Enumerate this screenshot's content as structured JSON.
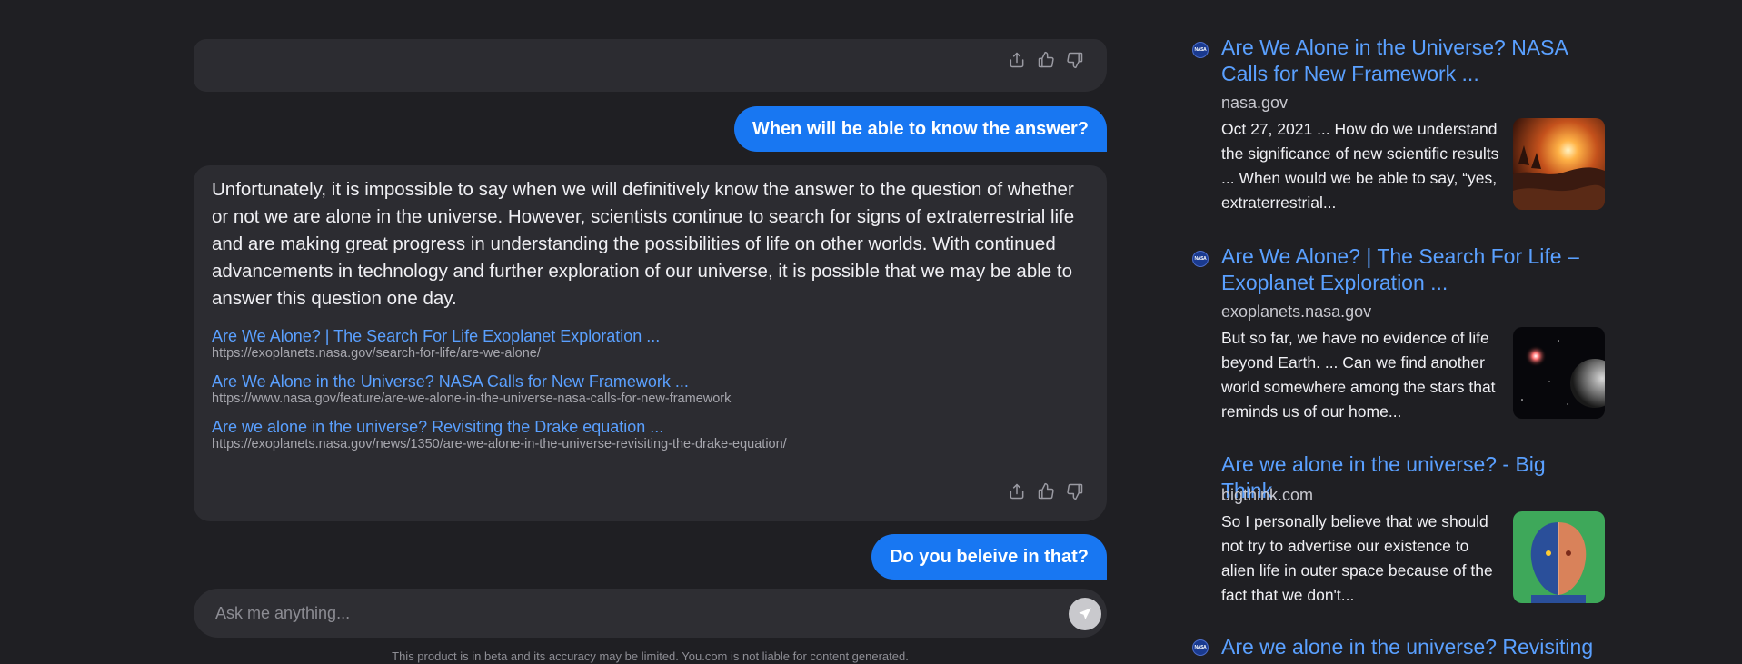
{
  "chat": {
    "user_messages": [
      "When will be able to know the answer?",
      "Do you beleive in that?"
    ],
    "answer": "Unfortunately, it is impossible to say when we will definitively know the answer to the question of whether or not we are alone in the universe. However, scientists continue to search for signs of extraterrestrial life and are making great progress in understanding the possibilities of life on other worlds. With continued advancements in technology and further exploration of our universe, it is possible that we may be able to answer this question one day.",
    "sources": [
      {
        "title": "Are We Alone? | The Search For Life Exoplanet Exploration ...",
        "url": "https://exoplanets.nasa.gov/search-for-life/are-we-alone/"
      },
      {
        "title": "Are We Alone in the Universe? NASA Calls for New Framework ...",
        "url": "https://www.nasa.gov/feature/are-we-alone-in-the-universe-nasa-calls-for-new-framework"
      },
      {
        "title": "Are we alone in the universe? Revisiting the Drake equation ...",
        "url": "https://exoplanets.nasa.gov/news/1350/are-we-alone-in-the-universe-revisiting-the-drake-equation/"
      }
    ],
    "input_placeholder": "Ask me anything...",
    "disclaimer": "This product is in beta and its accuracy may be limited. You.com is not liable for content generated.",
    "icons": [
      "share-icon",
      "thumbs-up-icon",
      "thumbs-down-icon",
      "send-icon"
    ]
  },
  "results": [
    {
      "favicon": "NASA",
      "title": "Are We Alone in the Universe? NASA Calls for New Framework ...",
      "domain": "nasa.gov",
      "snippet": "Oct 27, 2021 ... How do we understand the significance of new scientific results ... When would we be able to say, “yes, extraterrestrial...",
      "thumbnail": "alien-sunset-landscape"
    },
    {
      "favicon": "NASA",
      "title": "Are We Alone? | The Search For Life – Exoplanet Exploration ...",
      "domain": "exoplanets.nasa.gov",
      "snippet": "But so far, we have no evidence of life beyond Earth. ... Can we find another world somewhere among the stars that reminds us of our home...",
      "thumbnail": "planet-and-star-in-space"
    },
    {
      "favicon": "",
      "title": "Are we alone in the universe? - Big Think",
      "domain": "bigthink.com",
      "snippet": "So I personally believe that we should not try to advertise our existence to alien life in outer space because of the fact that we don't...",
      "thumbnail": "half-human-half-alien-face"
    },
    {
      "favicon": "NASA",
      "title": "Are we alone in the universe? Revisiting"
    }
  ],
  "colors": {
    "background": "#1f1f23",
    "bubble": "#2c2c31",
    "user_bubble": "#1877f2",
    "link": "#5aa0ff"
  }
}
